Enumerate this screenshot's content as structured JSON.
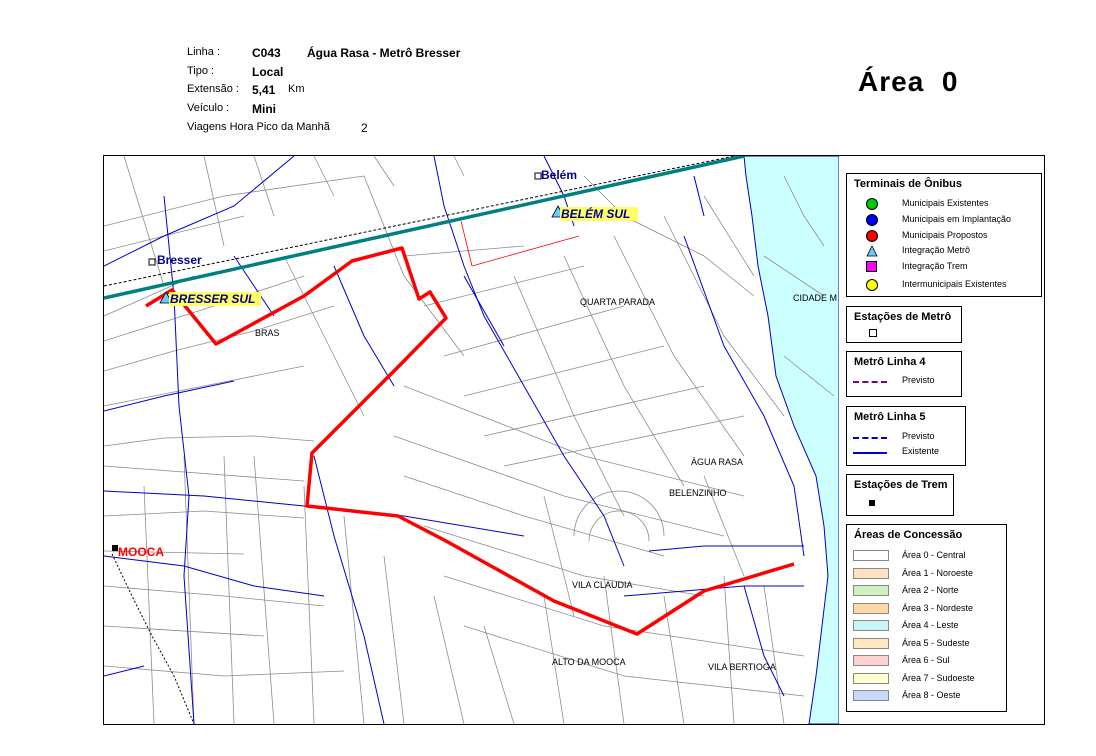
{
  "header": {
    "linha_label": "Linha :",
    "linha_code": "C043",
    "linha_name": "Água Rasa - Metrô Bresser",
    "tipo_label": "Tipo :",
    "tipo_value": "Local",
    "extensao_label": "Extensão :",
    "extensao_value": "5,41",
    "extensao_unit": "Km",
    "veiculo_label": "Veículo :",
    "veiculo_value": "Mini",
    "viagens_label": "Viagens Hora Pico da Manhã",
    "viagens_value": "2"
  },
  "area_title": "Área  0",
  "map": {
    "places": {
      "belem": "Belém",
      "belem_sul": "BELÉM SUL",
      "bresser": "Bresser",
      "bresser_sul": "BRESSER SUL",
      "bras": "BRAS",
      "quarta_parada": "QUARTA PARADA",
      "cidade_mae": "CIDADE M",
      "agua_rasa": "ÁGUA RASA",
      "belenzinho": "BELENZINHO",
      "mooca": "MOOCA",
      "vila_claudia": "VILA CLAUDIA",
      "alto_da_mooca": "ALTO DA MOOCA",
      "vila_bertioga": "VILA BERTIOGA"
    },
    "colors": {
      "route": "#ff0000",
      "metro_line": "#008080",
      "street": "#808080",
      "main_road": "#0000cc",
      "river_area": "#ccffff"
    }
  },
  "legend": {
    "terminais": {
      "title": "Terminais de Ônibus",
      "items": [
        {
          "label": "Municipais Existentes",
          "color": "#00cc00",
          "shape": "circle"
        },
        {
          "label": "Municipais em Implantação",
          "color": "#0000ff",
          "shape": "circle"
        },
        {
          "label": "Municipais Propostos",
          "color": "#ff0000",
          "shape": "circle"
        },
        {
          "label": "Integração Metrô",
          "color": "#66ccff",
          "shape": "triangle"
        },
        {
          "label": "Integração Trem",
          "color": "#ff00ff",
          "shape": "square"
        },
        {
          "label": "Intermunicipais Existentes",
          "color": "#ffff00",
          "shape": "circle"
        }
      ]
    },
    "estacoes_metro": {
      "title": "Estações de Metrô"
    },
    "metro_linha4": {
      "title": "Metrô Linha 4",
      "items": [
        {
          "label": "Previsto",
          "color": "#800080",
          "style": "dashed"
        }
      ]
    },
    "metro_linha5": {
      "title": "Metrô Linha 5",
      "items": [
        {
          "label": "Previsto",
          "color": "#0000cc",
          "style": "dashed"
        },
        {
          "label": "Existente",
          "color": "#0000cc",
          "style": "solid"
        }
      ]
    },
    "estacoes_trem": {
      "title": "Estações de Trem"
    },
    "areas": {
      "title": "Áreas de Concessão",
      "items": [
        {
          "label": "Área 0 - Central",
          "color": "#ffffff"
        },
        {
          "label": "Área 1 - Noroeste",
          "color": "#ffe0c0"
        },
        {
          "label": "Área 2 - Norte",
          "color": "#d0f0c0"
        },
        {
          "label": "Área 3 - Nordeste",
          "color": "#ffd8a8"
        },
        {
          "label": "Área 4 - Leste",
          "color": "#c8f4f4"
        },
        {
          "label": "Área 5 - Sudeste",
          "color": "#ffe8c0"
        },
        {
          "label": "Área 6 - Sul",
          "color": "#ffd0d0"
        },
        {
          "label": "Área 7 - Sudoeste",
          "color": "#ffffd0"
        },
        {
          "label": "Área 8 - Oeste",
          "color": "#c8d8f8"
        }
      ]
    }
  }
}
